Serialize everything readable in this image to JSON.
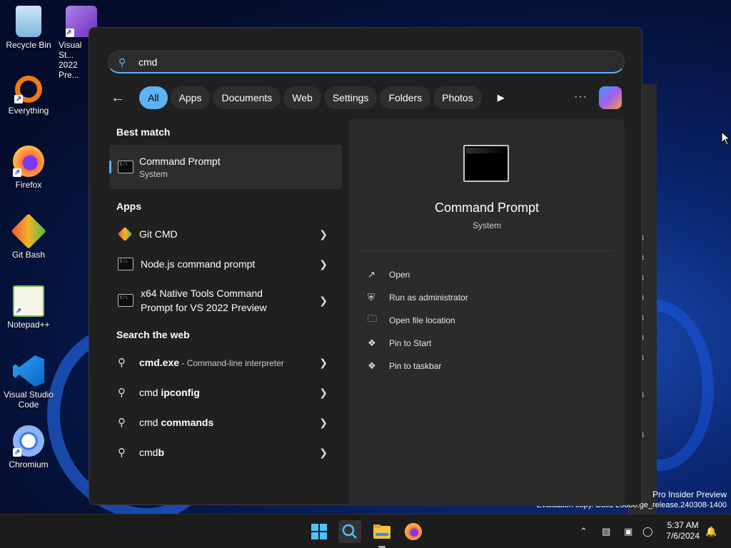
{
  "desktop": {
    "icons": [
      {
        "label": "Recycle Bin",
        "icon": "recycle-bin-icon"
      },
      {
        "label": "Visual St... 2022 Pre...",
        "icon": "visual-studio-icon"
      },
      {
        "label": "Everything",
        "icon": "everything-search-icon"
      },
      {
        "label": "Firefox",
        "icon": "firefox-icon"
      },
      {
        "label": "Git Bash",
        "icon": "git-bash-icon"
      },
      {
        "label": "Notepad++",
        "icon": "notepadpp-icon"
      },
      {
        "label": "Visual Studio Code",
        "icon": "vscode-icon"
      },
      {
        "label": "Chromium",
        "icon": "chromium-icon"
      }
    ],
    "watermark_line1": "Pro Insider Preview",
    "watermark_line2": "Evaluation copy. Build 26080.ge_release.240308-1400"
  },
  "search": {
    "query": "cmd",
    "filters": [
      "All",
      "Apps",
      "Documents",
      "Web",
      "Settings",
      "Folders",
      "Photos"
    ],
    "active_filter": "All",
    "sections": {
      "best_match": "Best match",
      "apps": "Apps",
      "web": "Search the web"
    },
    "best_match": {
      "title": "Command Prompt",
      "subtitle": "System"
    },
    "apps": [
      {
        "label": "Git CMD"
      },
      {
        "label": "Node.js command prompt"
      },
      {
        "label_line1": "x64 Native Tools Command",
        "label_line2": "Prompt for VS 2022 Preview"
      }
    ],
    "web": [
      {
        "bold": "cmd.exe",
        "rest": " - Command-line interpreter"
      },
      {
        "label": "cmd ",
        "bold": "ipconfig"
      },
      {
        "label": "cmd ",
        "bold": "commands"
      },
      {
        "label": "cmd",
        "bold": "b"
      }
    ],
    "preview": {
      "title": "Command Prompt",
      "subtitle": "System",
      "actions": [
        "Open",
        "Run as administrator",
        "Open file location",
        "Pin to Start",
        "Pin to taskbar"
      ]
    }
  },
  "taskbar": {
    "time": "5:37 AM",
    "date": "7/6/2024",
    "accent": "#4cc2ff"
  }
}
